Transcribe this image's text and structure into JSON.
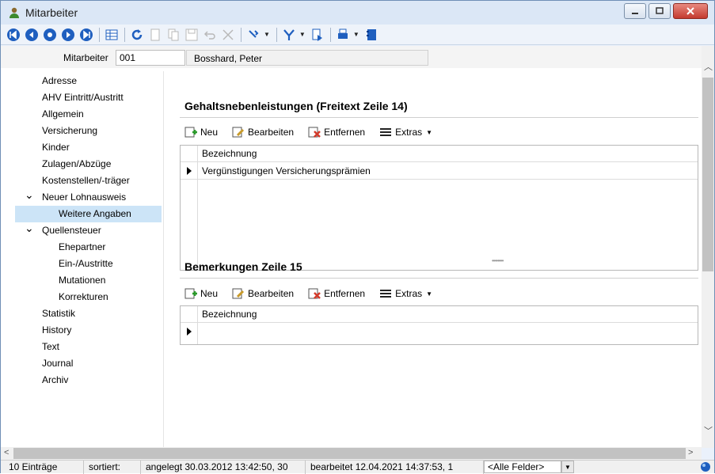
{
  "window": {
    "title": "Mitarbeiter"
  },
  "header": {
    "label": "Mitarbeiter",
    "number": "001",
    "name": "Bosshard, Peter"
  },
  "nav": {
    "items": [
      {
        "label": "Adresse",
        "level": 1
      },
      {
        "label": "AHV Eintritt/Austritt",
        "level": 1
      },
      {
        "label": "Allgemein",
        "level": 1
      },
      {
        "label": "Versicherung",
        "level": 1
      },
      {
        "label": "Kinder",
        "level": 1
      },
      {
        "label": "Zulagen/Abzüge",
        "level": 1
      },
      {
        "label": "Kostenstellen/-träger",
        "level": 1
      },
      {
        "label": "Neuer Lohnausweis",
        "level": 1,
        "expanded": true
      },
      {
        "label": "Weitere Angaben",
        "level": 2,
        "selected": true
      },
      {
        "label": "Quellensteuer",
        "level": 1,
        "expanded": true
      },
      {
        "label": "Ehepartner",
        "level": 2
      },
      {
        "label": "Ein-/Austritte",
        "level": 2
      },
      {
        "label": "Mutationen",
        "level": 2
      },
      {
        "label": "Korrekturen",
        "level": 2
      },
      {
        "label": "Statistik",
        "level": 1
      },
      {
        "label": "History",
        "level": 1
      },
      {
        "label": "Text",
        "level": 1
      },
      {
        "label": "Journal",
        "level": 1
      },
      {
        "label": "Archiv",
        "level": 1
      }
    ]
  },
  "section1": {
    "title": "Gehaltsnebenleistungen (Freitext Zeile 14)",
    "buttons": {
      "new": "Neu",
      "edit": "Bearbeiten",
      "remove": "Entfernen",
      "extras": "Extras"
    },
    "column": "Bezeichnung",
    "rows": [
      "Vergünstigungen Versicherungsprämien"
    ]
  },
  "section2": {
    "title": "Bemerkungen Zeile 15",
    "buttons": {
      "new": "Neu",
      "edit": "Bearbeiten",
      "remove": "Entfernen",
      "extras": "Extras"
    },
    "column": "Bezeichnung",
    "rows": [
      ""
    ]
  },
  "status": {
    "count": "10 Einträge",
    "sorted": "sortiert:",
    "created": "angelegt 30.03.2012 13:42:50, 30",
    "edited": "bearbeitet 12.04.2021 14:37:53, 1",
    "field_filter": "<Alle Felder>"
  },
  "colors": {
    "accent": "#1f5fbf",
    "selection": "#cce4f7",
    "close": "#c43a2f"
  },
  "icons": [
    "first-icon",
    "prev-icon",
    "stop-icon",
    "next-icon",
    "last-icon",
    "table-icon",
    "refresh-icon",
    "new-icon",
    "copy-icon",
    "save-icon",
    "undo-icon",
    "delete-icon",
    "tools-icon",
    "filter-icon",
    "export-icon",
    "print-icon",
    "book-icon"
  ]
}
